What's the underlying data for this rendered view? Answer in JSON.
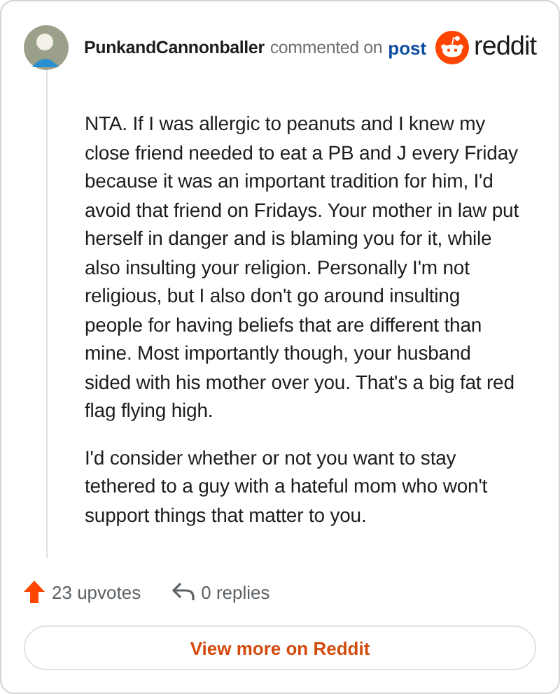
{
  "header": {
    "author": "PunkandCannonballer",
    "action": "commented on",
    "link": "post",
    "brand": "reddit"
  },
  "paragraphs": [
    "NTA. If I was allergic to peanuts and I knew my close friend needed to eat a PB and J every Friday because it was an important tradition for him, I'd avoid that friend on Fridays. Your mother in law put herself in danger and is blaming you for it, while also insulting your religion. Personally I'm not religious, but I also don't go around insulting people for having beliefs that are different than mine. Most importantly though, your husband sided with his mother over you. That's a big fat red flag flying high.",
    "I'd consider whether or not you want to stay tethered to a guy with a hateful mom who won't support things that matter to you."
  ],
  "footer": {
    "upvotes": "23 upvotes",
    "replies": "0 replies"
  },
  "button": "View more on Reddit"
}
